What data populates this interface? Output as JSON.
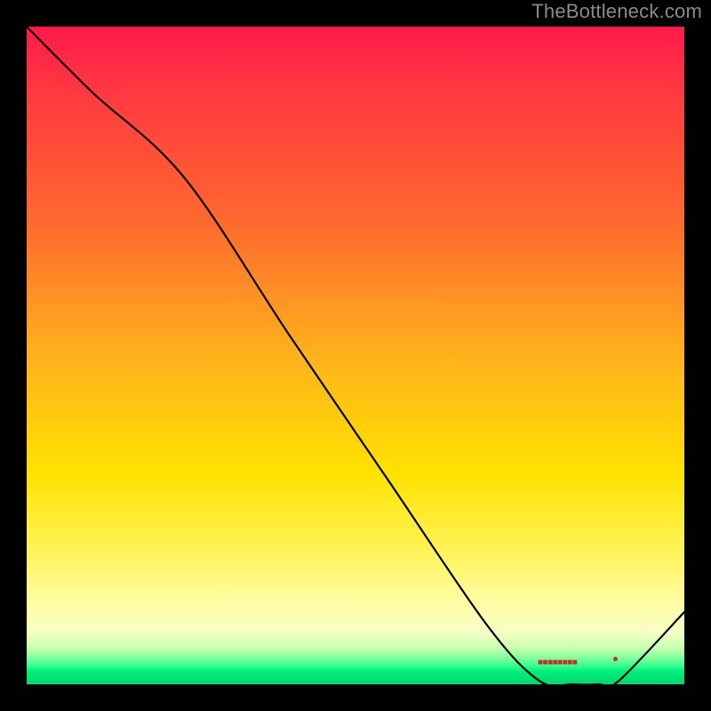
{
  "attribution": "TheBottleneck.com",
  "floor_label_text": "■■■■■■■■",
  "colors": {
    "attribution_text": "#8a8a8a",
    "curve_stroke": "#000000",
    "floor_marker": "#cf2a27",
    "background": "#000000"
  },
  "chart_data": {
    "type": "line",
    "title": "",
    "xlabel": "",
    "ylabel": "",
    "xlim": [
      0,
      100
    ],
    "ylim": [
      0,
      100
    ],
    "x": [
      0,
      10,
      24,
      40,
      55,
      70,
      78,
      83,
      87,
      90,
      100
    ],
    "y": [
      100,
      90,
      77,
      53,
      31,
      9,
      0.5,
      0,
      0,
      0.5,
      11
    ],
    "series": [
      {
        "name": "bottleneck-curve",
        "x": [
          0,
          10,
          24,
          40,
          55,
          70,
          78,
          83,
          87,
          90,
          100
        ],
        "y": [
          100,
          90,
          77,
          53,
          31,
          9,
          0.5,
          0,
          0,
          0.5,
          11
        ]
      }
    ],
    "annotations": [
      {
        "name": "optimal-marker",
        "x": 85,
        "y": 0.5
      },
      {
        "name": "optimal-dot",
        "x": 90.5,
        "y": 1.2
      }
    ]
  }
}
